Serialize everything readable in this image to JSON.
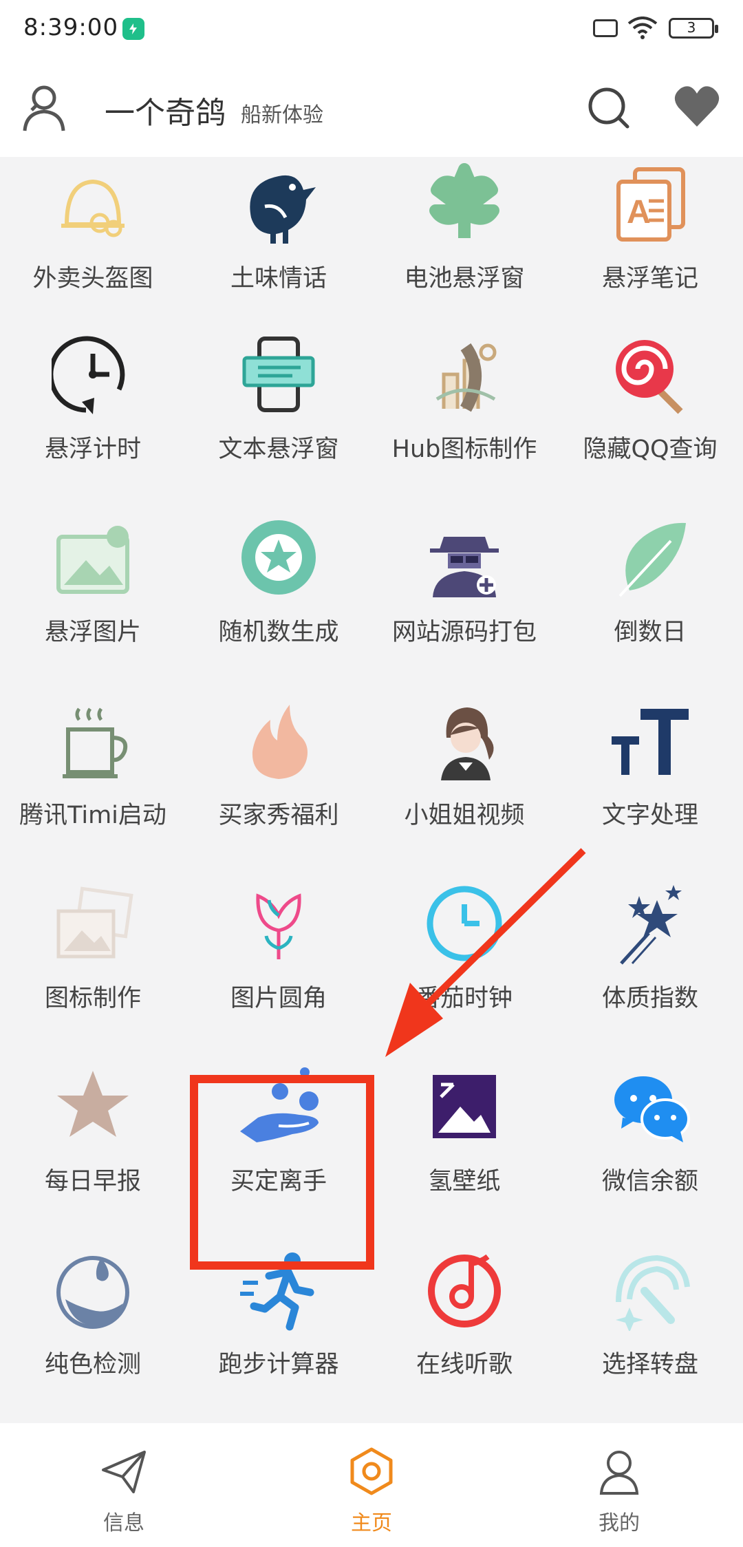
{
  "status_bar": {
    "time": "8:39:00",
    "battery": "3"
  },
  "header": {
    "title": "一个奇鸽",
    "subtitle": "船新体验"
  },
  "grid": [
    {
      "label": "外卖头盔图",
      "icon": "helmet-icon"
    },
    {
      "label": "土味情话",
      "icon": "bird-icon"
    },
    {
      "label": "电池悬浮窗",
      "icon": "leaf-icon"
    },
    {
      "label": "悬浮笔记",
      "icon": "notes-icon"
    },
    {
      "label": "悬浮计时",
      "icon": "timer-icon"
    },
    {
      "label": "文本悬浮窗",
      "icon": "text-window-icon"
    },
    {
      "label": "Hub图标制作",
      "icon": "hub-icon"
    },
    {
      "label": "隐藏QQ查询",
      "icon": "lollipop-icon"
    },
    {
      "label": "悬浮图片",
      "icon": "image-icon"
    },
    {
      "label": "随机数生成",
      "icon": "star-circle-icon"
    },
    {
      "label": "网站源码打包",
      "icon": "spy-icon"
    },
    {
      "label": "倒数日",
      "icon": "feather-icon"
    },
    {
      "label": "腾讯Timi启动",
      "icon": "coffee-icon"
    },
    {
      "label": "买家秀福利",
      "icon": "flame-icon"
    },
    {
      "label": "小姐姐视频",
      "icon": "girl-icon"
    },
    {
      "label": "文字处理",
      "icon": "text-size-icon"
    },
    {
      "label": "图标制作",
      "icon": "photo-stack-icon"
    },
    {
      "label": "图片圆角",
      "icon": "tulip-icon"
    },
    {
      "label": "番茄时钟",
      "icon": "clock-icon"
    },
    {
      "label": "体质指数",
      "icon": "magic-wand-icon"
    },
    {
      "label": "每日早报",
      "icon": "star-icon"
    },
    {
      "label": "买定离手",
      "icon": "hand-balls-icon"
    },
    {
      "label": "氢壁纸",
      "icon": "wallpaper-icon"
    },
    {
      "label": "微信余额",
      "icon": "wechat-icon"
    },
    {
      "label": "纯色检测",
      "icon": "drop-icon"
    },
    {
      "label": "跑步计算器",
      "icon": "runner-icon"
    },
    {
      "label": "在线听歌",
      "icon": "music-icon"
    },
    {
      "label": "选择转盘",
      "icon": "spinner-icon"
    }
  ],
  "nav": [
    {
      "label": "信息",
      "icon": "send-icon"
    },
    {
      "label": "主页",
      "icon": "home-hex-icon"
    },
    {
      "label": "我的",
      "icon": "person-icon"
    }
  ],
  "colors": {
    "accent": "#f08a1c",
    "highlight": "#f0361c"
  }
}
